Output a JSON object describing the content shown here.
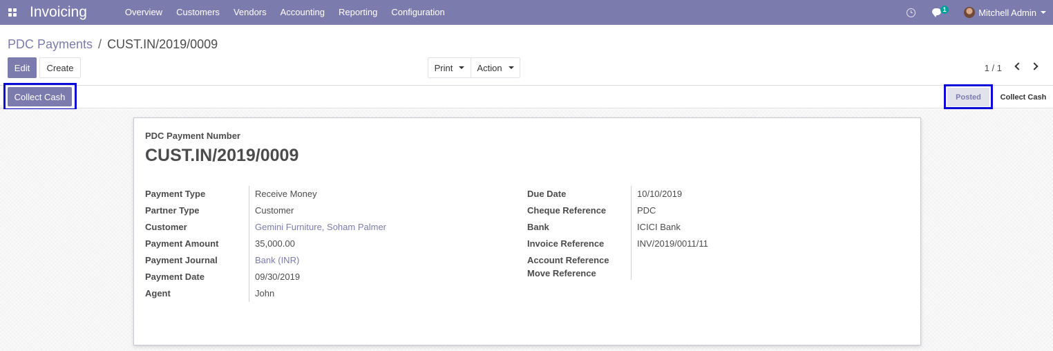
{
  "navbar": {
    "app_title": "Invoicing",
    "menu": [
      "Overview",
      "Customers",
      "Vendors",
      "Accounting",
      "Reporting",
      "Configuration"
    ],
    "chat_badge": "1",
    "user_name": "Mitchell Admin",
    "icons": [
      "apps-icon",
      "clock-icon",
      "chat-icon",
      "avatar",
      "caret-down-icon"
    ]
  },
  "control_panel": {
    "breadcrumb_parent": "PDC Payments",
    "breadcrumb_separator": "/",
    "breadcrumb_current": "CUST.IN/2019/0009",
    "edit_label": "Edit",
    "create_label": "Create",
    "print_label": "Print",
    "action_label": "Action",
    "pager": "1 / 1"
  },
  "statusbar": {
    "collect_cash_button": "Collect Cash",
    "stages": [
      {
        "label": "Posted",
        "active": true
      },
      {
        "label": "Collect Cash",
        "active": false
      }
    ]
  },
  "sheet": {
    "number_label": "PDC Payment Number",
    "title": "CUST.IN/2019/0009",
    "left_fields": [
      {
        "label": "Payment Type",
        "value": "Receive Money",
        "link": false
      },
      {
        "label": "Partner Type",
        "value": "Customer",
        "link": false
      },
      {
        "label": "Customer",
        "value": "Gemini Furniture, Soham Palmer",
        "link": true
      },
      {
        "label": "Payment Amount",
        "value": "35,000.00",
        "link": false
      },
      {
        "label": "Payment Journal",
        "value": "Bank (INR)",
        "link": true
      },
      {
        "label": "Payment Date",
        "value": "09/30/2019",
        "link": false
      },
      {
        "label": "Agent",
        "value": "John",
        "link": false
      }
    ],
    "right_fields": [
      {
        "label": "Due Date",
        "value": "10/10/2019"
      },
      {
        "label": "Cheque Reference",
        "value": "PDC"
      },
      {
        "label": "Bank",
        "value": "ICICI Bank"
      },
      {
        "label": "Invoice Reference",
        "value": "INV/2019/0011/11"
      },
      {
        "label": "Account Reference",
        "value": ""
      },
      {
        "label": "Move Reference",
        "value": ""
      }
    ]
  },
  "colors": {
    "brand": "#7c7bad",
    "highlight": "#0b0bd8",
    "badge": "#00a09d"
  }
}
